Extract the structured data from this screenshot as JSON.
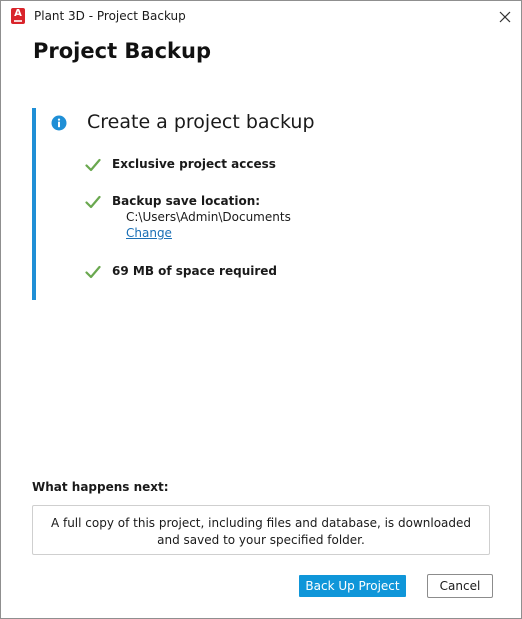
{
  "window": {
    "title": "Plant 3D - Project Backup",
    "app_icon_letter": "A",
    "app_icon_color": "#d9242b"
  },
  "page": {
    "title": "Project Backup"
  },
  "panel": {
    "heading": "Create a project backup",
    "accent_color": "#1f8fd6",
    "steps": [
      {
        "label": "Exclusive project access"
      },
      {
        "label": "Backup save location:",
        "path": "C:\\Users\\Admin\\Documents",
        "link": "Change"
      },
      {
        "label": "69 MB of space required"
      }
    ]
  },
  "next": {
    "heading": "What happens next:",
    "description": "A full copy of this project, including files and database, is downloaded and saved to your specified folder."
  },
  "buttons": {
    "primary_label": "Back Up Project",
    "cancel_label": "Cancel"
  },
  "colors": {
    "primary": "#0f96d9",
    "check": "#6aa84f",
    "link": "#1a6fb5"
  },
  "icons": [
    "app-icon",
    "close-icon",
    "info-icon",
    "check-icon"
  ]
}
